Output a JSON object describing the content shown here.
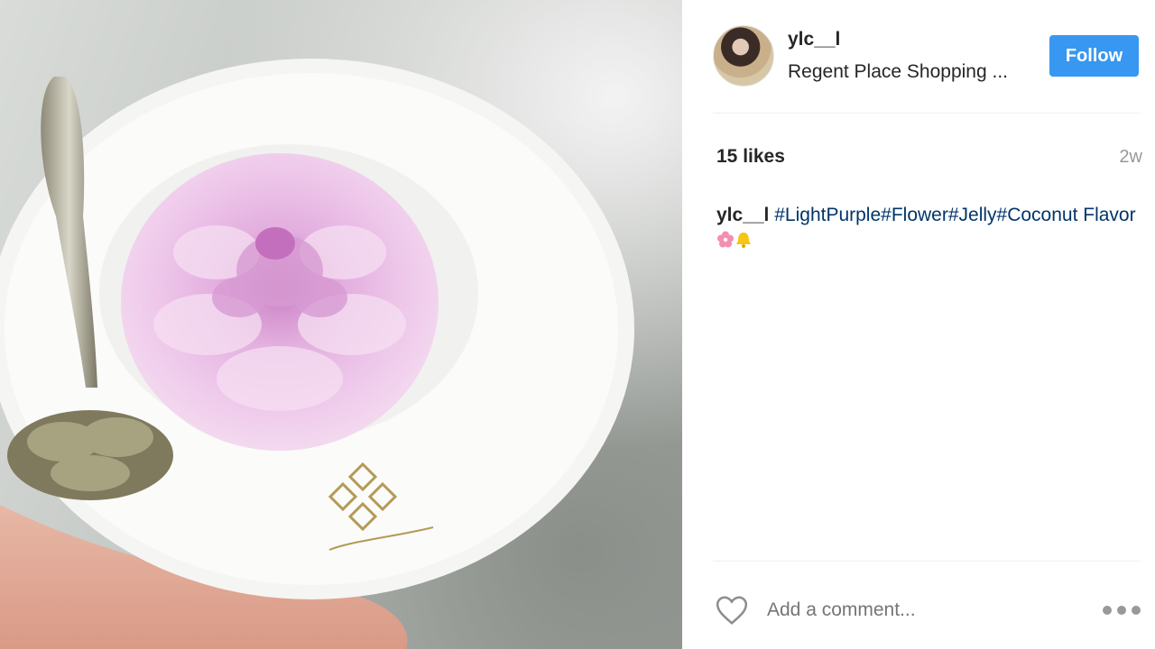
{
  "post": {
    "username": "ylc__l",
    "location": "Regent Place Shopping ...",
    "follow_label": "Follow",
    "likes": "15 likes",
    "time": "2w",
    "caption_user": "ylc__l",
    "caption_tags": "#LightPurple#Flower#Jelly#Coconut Flavor",
    "comment_placeholder": "Add a comment...",
    "accent_color": "#3897f0"
  },
  "icons": {
    "avatar": "user-avatar",
    "like": "heart-icon",
    "more": "more-options-icon",
    "emoji_1": "cherry-blossom-emoji",
    "emoji_2": "bell-emoji"
  }
}
